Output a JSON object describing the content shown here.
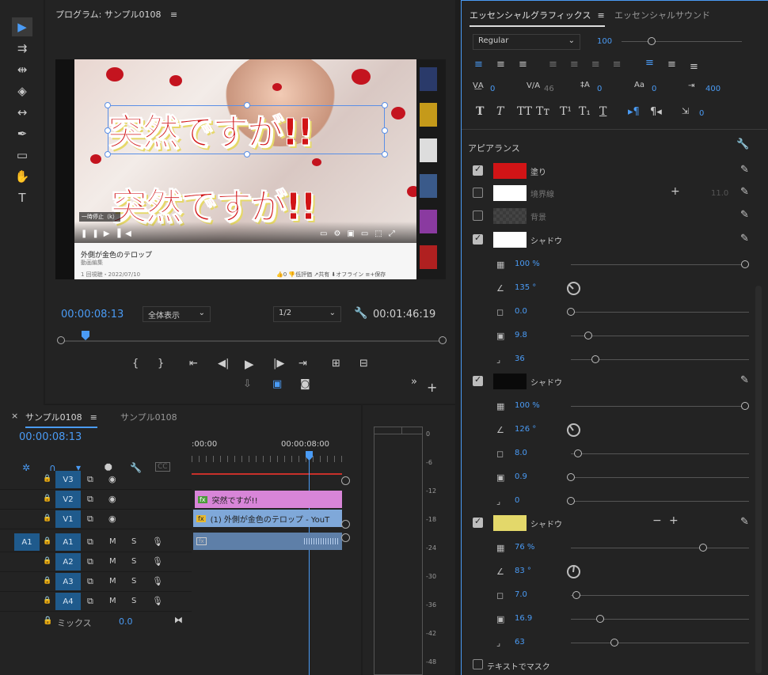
{
  "program": {
    "title": "プログラム: サンプル0108",
    "menu_icon": "≡",
    "current_tc": "00:00:08:13",
    "fit_label": "全体表示",
    "resolution": "1/2",
    "duration": "00:01:46:19",
    "playhead_fraction": 0.065
  },
  "video": {
    "telop_top": "突然ですが!!",
    "telop_bottom": "突然ですが!!",
    "yt_title": "外側が金色のテロップ",
    "yt_meta": "1 回視聴・2022/07/10",
    "yt_badge": "一時停止（k）",
    "yt_actions": "👍0  👎低評価  ↗共有  ⬇オフライン  ≡+保存",
    "channel": "動画編集"
  },
  "timeline": {
    "tab_active": "サンプル0108",
    "tab_other": "サンプル0108",
    "tc": "00:00:08:13",
    "ruler_start": ":00:00",
    "ruler_mid": "00:00:08:00",
    "tracks": [
      {
        "name": "V3",
        "type": "video"
      },
      {
        "name": "V2",
        "type": "video"
      },
      {
        "name": "V1",
        "type": "video"
      },
      {
        "name": "A1",
        "type": "audio",
        "src": "A1"
      },
      {
        "name": "A2",
        "type": "audio"
      },
      {
        "name": "A3",
        "type": "audio"
      },
      {
        "name": "A4",
        "type": "audio"
      }
    ],
    "clip_v2": "突然ですが!!",
    "clip_v1": "(1) 外側が金色のテロップ - YouT",
    "mix_label": "ミックス",
    "mix_value": "0.0",
    "m_label": "M",
    "s_label": "S"
  },
  "meter": {
    "ticks": [
      "0",
      "-6",
      "-12",
      "-18",
      "-24",
      "-30",
      "-36",
      "-42",
      "-48"
    ]
  },
  "eg": {
    "tab_active": "エッセンシャルグラフィックス",
    "tab_other": "エッセンシャルサウンド",
    "font_style": "Regular",
    "font_size": "100",
    "font_size_fraction": 0.25,
    "kerning": "0",
    "tracking": "46",
    "leading": "0",
    "baseline": "0",
    "tsume": "400",
    "tab_width": "0",
    "appearance_label": "アピアランス",
    "fill": {
      "label": "塗り",
      "color": "#d11416",
      "checked": true
    },
    "stroke": {
      "label": "境界線",
      "color": "#ffffff",
      "checked": false,
      "width": "11.0"
    },
    "background": {
      "label": "背景",
      "color": "#555555",
      "checked": false
    },
    "shadow1": {
      "label": "シャドウ",
      "color": "#ffffff",
      "checked": true,
      "opacity": "100 %",
      "angle": "135 °",
      "distance": "0.0",
      "size": "9.8",
      "blur": "36",
      "opacity_f": 1.0,
      "distance_f": 0.0,
      "size_f": 0.1,
      "blur_f": 0.14
    },
    "shadow2": {
      "label": "シャドウ",
      "color": "#0a0a0a",
      "checked": true,
      "opacity": "100 %",
      "angle": "126 °",
      "distance": "8.0",
      "size": "0.9",
      "blur": "0",
      "opacity_f": 1.0,
      "distance_f": 0.04,
      "size_f": 0.0,
      "blur_f": 0.0
    },
    "shadow3": {
      "label": "シャドウ",
      "color": "#e3d86a",
      "checked": true,
      "opacity": "76 %",
      "angle": "83 °",
      "distance": "7.0",
      "size": "16.9",
      "blur": "63",
      "opacity_f": 0.76,
      "distance_f": 0.03,
      "size_f": 0.17,
      "blur_f": 0.25
    },
    "mask_label": "テキストでマスク"
  }
}
